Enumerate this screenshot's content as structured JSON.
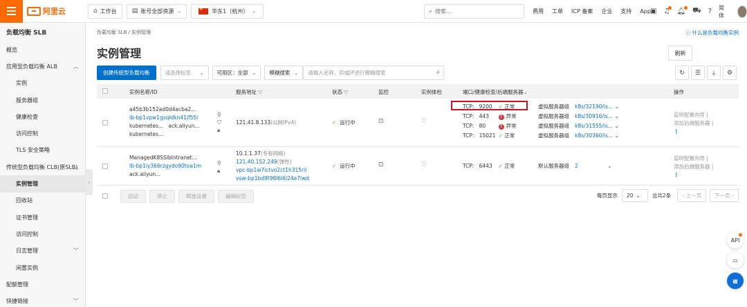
{
  "topbar": {
    "brand": "阿里云",
    "workbench": "工作台",
    "account_resources": "账号全部资源",
    "region": "华东1（杭州）",
    "search_placeholder": "搜索...",
    "links": [
      "费用",
      "工单",
      "ICP 备案",
      "企业",
      "支持",
      "App"
    ],
    "language": "简体"
  },
  "sidebar": {
    "title": "负载均衡 SLB",
    "items": [
      {
        "label": "概览",
        "level": 0
      },
      {
        "label": "应用型负载均衡 ALB",
        "level": 0,
        "expandable": true
      },
      {
        "label": "实例",
        "level": 1
      },
      {
        "label": "服务器组",
        "level": 1
      },
      {
        "label": "健康检查",
        "level": 1
      },
      {
        "label": "访问控制",
        "level": 1
      },
      {
        "label": "TLS 安全策略",
        "level": 1
      },
      {
        "label": "传统型负载均衡 CLB(原SLB)",
        "level": 0,
        "expandable": true
      },
      {
        "label": "实例管理",
        "level": 1,
        "active": true
      },
      {
        "label": "回收站",
        "level": 1
      },
      {
        "label": "证书管理",
        "level": 1
      },
      {
        "label": "访问控制",
        "level": 1
      },
      {
        "label": "日志管理",
        "level": 1,
        "expandable": true
      },
      {
        "label": "闲置实例",
        "level": 1
      },
      {
        "label": "配额管理",
        "level": 0
      },
      {
        "label": "快捷链接",
        "level": 0,
        "expandable": true
      }
    ]
  },
  "main": {
    "breadcrumb": "负载均衡 SLB  /  实例管理",
    "help_link": "什么是负载均衡实例",
    "title": "实例管理",
    "refresh": "刷新",
    "toolbar": {
      "create": "创建传统型负载均衡",
      "tag_placeholder": "请选择标签",
      "zone_label": "可用区：",
      "zone_value": "全部",
      "search_mode": "模糊搜索",
      "keyword_placeholder": "请输入名称、ID或IP进行模糊搜索"
    },
    "columns": {
      "name": "实例名称/ID",
      "address": "服务地址",
      "status": "状态",
      "monitor": "监控",
      "health": "实例体检",
      "ports": "端口/健康检查/后端服务器",
      "actions": "操作"
    },
    "rows": [
      {
        "name": "a45b3b152ad0d4acba2...",
        "id": "lb-bp1vpw1gsqldkn41jf55l",
        "tags": [
          "kubernetes...",
          "ack.aliyun...",
          "kubernetes..."
        ],
        "address": "121.41.8.133",
        "address_type": "(公网IPv4)",
        "status": "运行中",
        "listeners": [
          {
            "proto": "TCP:",
            "port": "9200",
            "health": "正常",
            "ok": true,
            "group": "虚拟服务器组",
            "target": "k8s/32190/is..."
          },
          {
            "proto": "TCP:",
            "port": "443",
            "health": "异常",
            "ok": false,
            "group": "虚拟服务器组",
            "target": "k8s/30916/is..."
          },
          {
            "proto": "TCP:",
            "port": "80",
            "health": "异常",
            "ok": false,
            "group": "虚拟服务器组",
            "target": "k8s/31555/is..."
          },
          {
            "proto": "TCP:",
            "port": "15021",
            "health": "正常",
            "ok": true,
            "group": "虚拟服务器组",
            "target": "k8s/30360/is..."
          }
        ],
        "actions": [
          "监听配置向导",
          "添加后端服务器"
        ]
      },
      {
        "name": "ManagedK8SSlbIntranet...",
        "id": "lb-bp1iy366rzgydo90toa1m",
        "tags": [
          "ack.aliyun..."
        ],
        "address": "10.1.1.37",
        "address_type": "(专有网络)",
        "address2": "121.40.152.249",
        "address2_type": "(弹性)",
        "vpc": "vpc-bp1w7ictvo2ct1h315ril",
        "vsw": "vsw-bp1bd9t98l6l6l24e7lwd",
        "status": "运行中",
        "listeners": [
          {
            "proto": "TCP:",
            "port": "6443",
            "health": "正常",
            "ok": true,
            "group": "默认服务器组",
            "target": "2"
          }
        ],
        "actions": [
          "监听配置向导",
          "添加后端服务器"
        ]
      }
    ],
    "batch": [
      "启动",
      "停止",
      "释放设置",
      "编辑标签"
    ],
    "pager": {
      "per_page_label": "每页显示",
      "per_page": "20",
      "total": "总共2条",
      "prev": "上一页",
      "next": "下一页"
    }
  },
  "colors": {
    "accent": "#0070cc",
    "brand": "#ff6a00",
    "ok": "#2aa44a",
    "error": "#d9363e"
  }
}
